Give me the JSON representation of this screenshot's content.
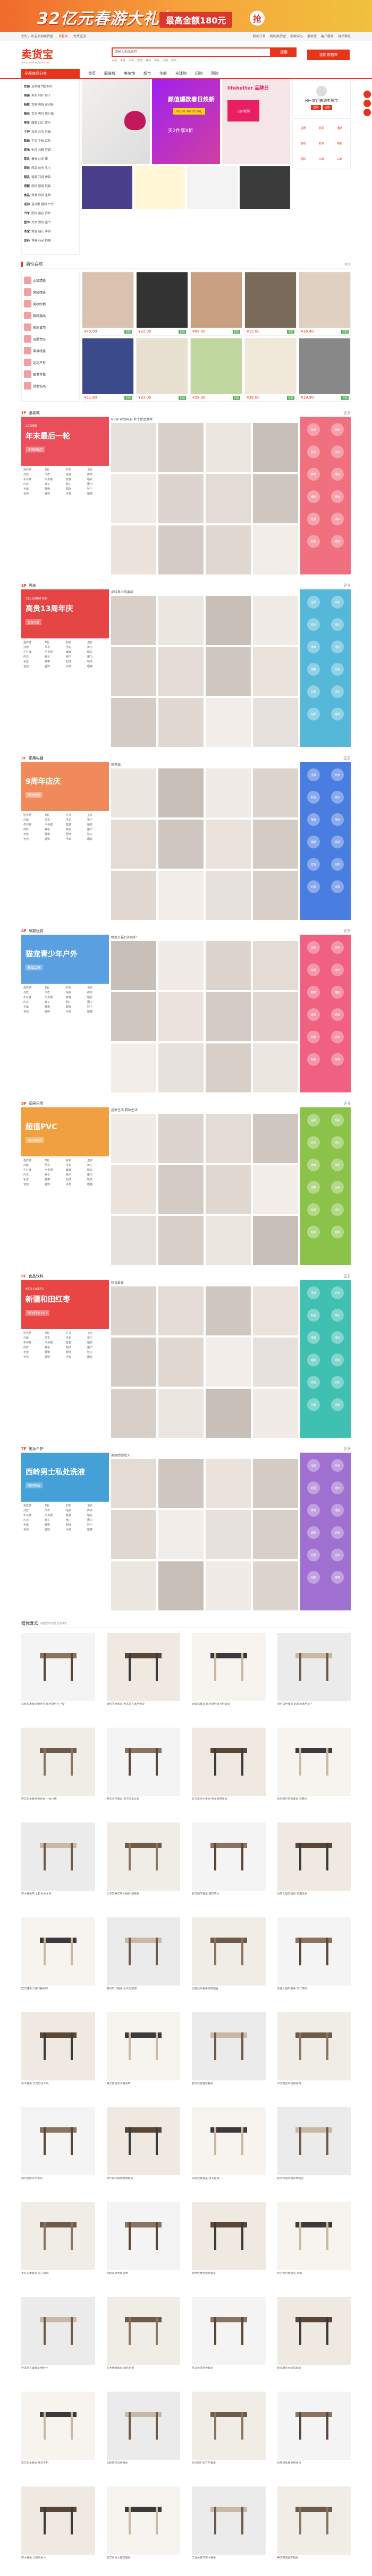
{
  "banner": {
    "slogan": "32亿元春游大礼包",
    "amount": "最高金额180元",
    "grab": "抢"
  },
  "sitenav": {
    "left": [
      "您好，欢迎来到卖货宝",
      "请登录",
      "免费注册"
    ],
    "right": [
      "我的订单",
      "我的卖货宝",
      "卖家中心",
      "手机版",
      "客户服务",
      "网站导航"
    ]
  },
  "header": {
    "logo": "卖货宝",
    "logo_sub": "www.maihuobao.com",
    "search_placeholder": "请输入商品名称",
    "search_btn": "搜索",
    "hot": [
      "女装",
      "男装",
      "手机",
      "家电",
      "美妆",
      "零食",
      "母婴",
      "家具"
    ],
    "cart": "我的购物车"
  },
  "catnav": {
    "all": "全部商品分类",
    "items": [
      "首页",
      "服装城",
      "美妆馆",
      "超市",
      "生鲜",
      "全球购",
      "闪购",
      "团购"
    ]
  },
  "sidemenu": [
    {
      "main": "女装",
      "subs": "连衣裙 T恤 衬衫"
    },
    {
      "main": "男装",
      "subs": "夹克 衬衫 裤子"
    },
    {
      "main": "鞋靴",
      "subs": "女鞋 男鞋 运动鞋"
    },
    {
      "main": "箱包",
      "subs": "女包 男包 旅行箱"
    },
    {
      "main": "美妆",
      "subs": "面膜 口红 香水"
    },
    {
      "main": "个护",
      "subs": "洗发 沐浴 牙膏"
    },
    {
      "main": "数码",
      "subs": "手机 平板 耳机"
    },
    {
      "main": "家电",
      "subs": "电视 冰箱 空调"
    },
    {
      "main": "家具",
      "subs": "餐桌 沙发 床"
    },
    {
      "main": "家纺",
      "subs": "床品 枕头 毛巾"
    },
    {
      "main": "厨具",
      "subs": "锅具 刀具 餐具"
    },
    {
      "main": "母婴",
      "subs": "奶粉 尿裤 玩具"
    },
    {
      "main": "食品",
      "subs": "零食 饮料 生鲜"
    },
    {
      "main": "运动",
      "subs": "运动服 器材 户外"
    },
    {
      "main": "汽车",
      "subs": "配件 用品 养护"
    },
    {
      "main": "图书",
      "subs": "文学 教育 童书"
    },
    {
      "main": "珠宝",
      "subs": "黄金 钻石 手表"
    },
    {
      "main": "医药",
      "subs": "保健 药品 器械"
    }
  ],
  "hero": {
    "promo_title": "颜值爆款春日焕新",
    "promo_tag": "NEW ARRIVAL",
    "promo_sub": "买2件享8折",
    "banner2_title": "lifebetter 品牌日",
    "banner2_cta": "立即抢购"
  },
  "login": {
    "greet": "Hi~欢迎来到卖货宝",
    "login": "登录",
    "register": "注册"
  },
  "quick": [
    "话费",
    "机票",
    "酒店",
    "游戏",
    "彩票",
    "电影",
    "理财",
    "众筹",
    "白条"
  ],
  "rec": {
    "title": "猜你喜欢",
    "more": "更多",
    "side": [
      "女装精选",
      "男装精选",
      "美妆好物",
      "数码潮品",
      "家居日用",
      "母婴专区",
      "零食特惠",
      "运动户外",
      "图书音像",
      "珠宝饰品"
    ],
    "prices": [
      "¥45.00",
      "¥32.00",
      "¥99.00",
      "¥15.00",
      "¥38.40",
      "¥21.90",
      "¥33.00",
      "¥28.00",
      "¥39.00",
      "¥19.90"
    ],
    "tag": "包邮"
  },
  "floors": [
    {
      "num": "1F",
      "name": "服装城",
      "mid_title": "NEW WOMEN 女士新品推荐",
      "ban_en": "LADIES",
      "ban_cn": "年末最后一轮",
      "ban_sub": "全场5折起",
      "color": "#e94f5a",
      "right_color": "#f07080",
      "more": "更多"
    },
    {
      "num": "2F",
      "name": "男装",
      "mid_title": "品味男士风度款",
      "ban_en": "CELEBRATION",
      "ban_cn": "高贵13周年庆",
      "ban_sub": "低至1折",
      "color": "#e64545",
      "right_color": "#55b8d8",
      "more": "更多"
    },
    {
      "num": "3F",
      "name": "家用电器",
      "mid_title": "家电馆",
      "ban_en": "",
      "ban_cn": "9周年店庆",
      "ban_sub": "限时抢购",
      "color": "#f08a5a",
      "right_color": "#4a7de0",
      "more": "更多"
    },
    {
      "num": "4F",
      "name": "母婴玩具",
      "mid_title": "给宝贝最好的呵护",
      "ban_en": "",
      "ban_cn": "猫宠青少年户外",
      "ban_sub": "新品上市",
      "color": "#5aa0e0",
      "right_color": "#f06080",
      "more": "更多"
    },
    {
      "num": "5F",
      "name": "家居日用",
      "mid_title": "居家生活 精致生活",
      "ban_en": "",
      "ban_cn": "超值PVC",
      "ban_sub": "满99减20",
      "color": "#f0a040",
      "right_color": "#8bc34a",
      "more": "更多"
    },
    {
      "num": "6F",
      "name": "食品饮料",
      "mid_title": "吃货最爱",
      "ban_en": "RED DATES",
      "ban_cn": "新疆和田红枣",
      "ban_sub": "限时特价14.8",
      "color": "#e84545",
      "right_color": "#40c0b0",
      "more": "更多"
    },
    {
      "num": "7F",
      "name": "美妆个护",
      "mid_title": "美丽由你定义",
      "ban_en": "",
      "ban_cn": "西岭男士私处洗液",
      "ban_sub": "限时特价",
      "color": "#45a0d8",
      "right_color": "#a070d0",
      "more": "更多"
    }
  ],
  "floor_tags": [
    "连衣裙",
    "T恤",
    "衬衫",
    "卫衣",
    "外套",
    "风衣",
    "毛衣",
    "裤子",
    "牛仔裤",
    "半身裙",
    "套装",
    "睡衣",
    "内衣",
    "袜子",
    "帽子",
    "围巾",
    "手套",
    "腰带",
    "配饰",
    "鞋子",
    "包包",
    "首饰",
    "手表",
    "眼镜"
  ],
  "floor_right": [
    "品牌",
    "热卖",
    "新品",
    "特价",
    "推荐",
    "精选",
    "爆款",
    "促销",
    "优惠",
    "折扣",
    "包邮",
    "直降"
  ],
  "furniture": {
    "title": "猜你喜欢",
    "subtitle": "根据您的浏览记录推荐",
    "items": [
      "北欧实木餐桌椅组合 现代简约小户型",
      "圆形实木餐桌 美式复古家用饭桌",
      "大理石餐桌 现代简约长方形饭桌",
      "简约白色餐桌 北欧风家用桌子",
      "中式实木餐桌椅组合 一桌六椅",
      "美式乡村餐桌 复古实木长桌",
      "长方形实木餐桌 橡木家用饭桌",
      "现代简约岩板餐桌 轻奢风",
      "实木餐桌椅 北欧风原木色",
      "长方形美式实木餐桌 胡桃色",
      "欧式圆形餐桌 雕花实木",
      "轻奢大理石圆桌 家用饭桌",
      "欧式雕花大理石餐桌椅",
      "简约现代餐桌 小户型家用",
      "北欧风白色餐桌椅组合",
      "黑色大理石餐桌 现代简约",
      "实木餐桌 长方形原木风",
      "美式复古实木餐桌椅",
      "欧式白色雕花餐桌",
      "法式复古白色餐桌椅",
      "简约北欧实木餐桌",
      "现代简约钢化玻璃餐桌",
      "白色岩板餐桌 意式极简",
      "欧式大理石餐桌椅组合",
      "美式实木餐桌 复古做旧",
      "北欧风原木餐桌椅",
      "现代轻奢大理石餐桌",
      "长方形岩板餐桌 家用",
      "中式新古典餐桌椅组合",
      "实木伸缩餐桌 圆形折叠",
      "意式极简岩板餐桌",
      "欧式雕花大理石圆桌",
      "复古实木餐桌 美式乡村",
      "北欧简约白色餐桌",
      "现代简约长方形餐桌",
      "轻奢岩板餐桌椅组合",
      "实木餐桌 北欧风原木",
      "欧式白色大理石餐桌",
      "工业风铁艺实木餐桌",
      "美式复古圆形餐桌"
    ]
  }
}
